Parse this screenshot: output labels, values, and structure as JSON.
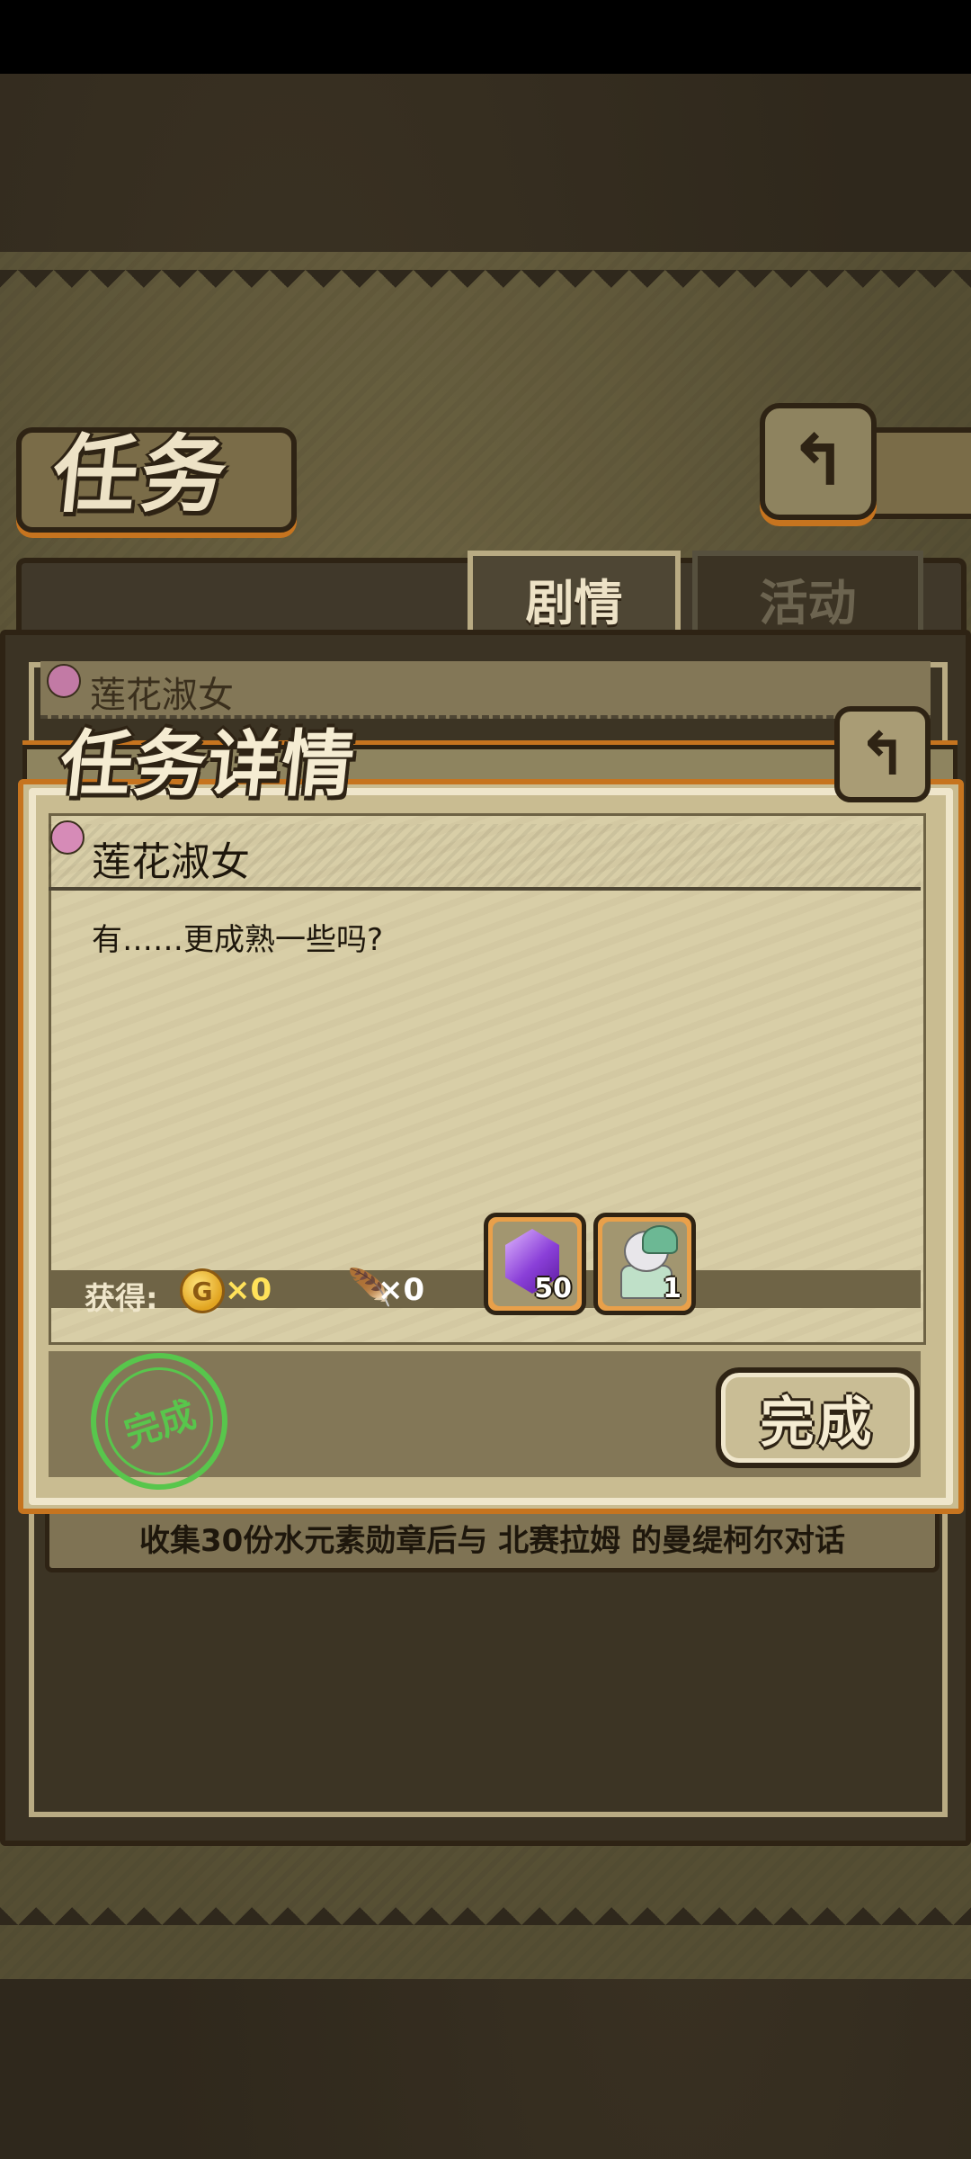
{
  "screen": {
    "title": "任务",
    "tabs": [
      {
        "label": "剧情",
        "active": true
      },
      {
        "label": "活动",
        "active": false
      }
    ],
    "quest_list": [
      {
        "name": "莲花淑女",
        "description": "收集30份水元素勋章后与 北赛拉姆 的曼缇柯尔对话"
      }
    ]
  },
  "dialog": {
    "title": "任务详情",
    "quest_name": "莲花淑女",
    "text": "有……更成熟一些吗?",
    "rewards_label": "获得:",
    "gold": "×0",
    "feather": "×0",
    "items": [
      {
        "icon": "purple-gem-icon",
        "count": "50"
      },
      {
        "icon": "character-card-icon",
        "count": "1"
      }
    ],
    "stamp_text": "完成",
    "complete_button": "完成"
  },
  "colors": {
    "accent_orange": "#c6741f",
    "stamp_green": "#58c64c",
    "gold_text": "#ffe25a"
  }
}
